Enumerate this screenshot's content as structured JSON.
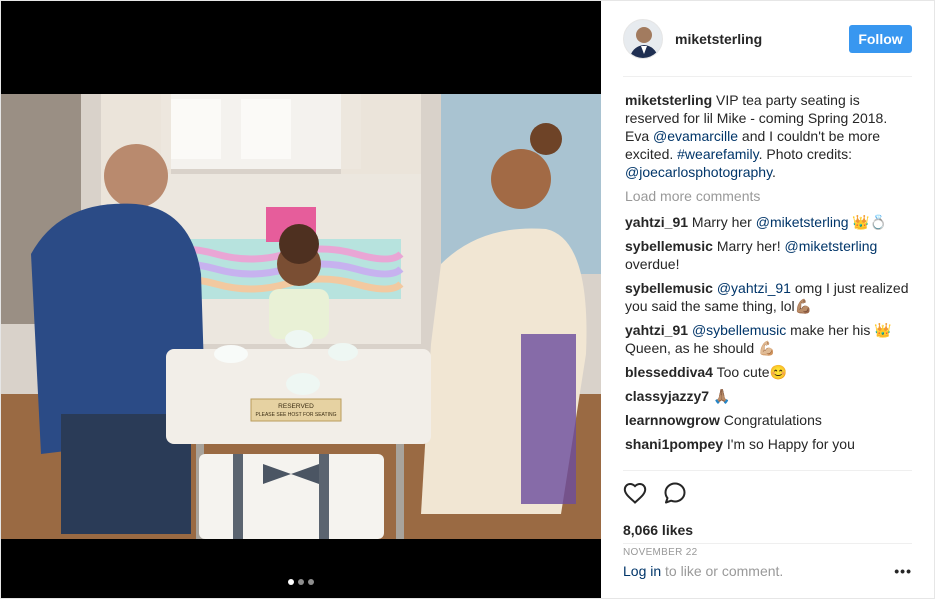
{
  "post": {
    "username": "miketsterling",
    "follow_label": "Follow",
    "caption": {
      "part1": " VIP tea party seating is reserved for lil Mike - coming Spring 2018. Eva ",
      "mention1": "@evamarcille",
      "part2": " and I couldn't be more excited. ",
      "hashtag": "#wearefamily",
      "part3": ". Photo credits: ",
      "mention2": "@joecarlosphotography",
      "part4": "."
    },
    "load_more": "Load more comments",
    "comments": [
      {
        "user": "yahtzi_91",
        "pre": " Marry her ",
        "mention": "@miketsterling",
        "post": " 👑💍"
      },
      {
        "user": "sybellemusic",
        "pre": " Marry her! ",
        "mention": "@miketsterling",
        "post": " overdue!"
      },
      {
        "user": "sybellemusic",
        "pre": " ",
        "mention": "@yahtzi_91",
        "post": " omg I just realized you said the same thing, lol💪🏽"
      },
      {
        "user": "yahtzi_91",
        "pre": " ",
        "mention": "@sybellemusic",
        "post": " make her his 👑 Queen, as he should 💪🏼"
      },
      {
        "user": "blesseddiva4",
        "pre": " Too cute😊",
        "mention": "",
        "post": ""
      },
      {
        "user": "classyjazzy7",
        "pre": " 🙏🏽",
        "mention": "",
        "post": ""
      },
      {
        "user": "learnnowgrow",
        "pre": " Congratulations",
        "mention": "",
        "post": ""
      },
      {
        "user": "shani1pompey",
        "pre": " I'm so Happy for you",
        "mention": "",
        "post": ""
      }
    ],
    "likes": "8,066 likes",
    "date": "NOVEMBER 22",
    "login_link": "Log in",
    "login_rest": " to like or comment.",
    "more_label": "•••",
    "photo_sign": [
      "RESERVED",
      "PLEASE SEE HOST FOR SEATING"
    ],
    "carousel": {
      "count": 3,
      "active": 1
    }
  },
  "icons": [
    "heart-icon",
    "comment-icon",
    "more-options-icon"
  ],
  "colors": {
    "follow": "#3897f0",
    "link": "#003569",
    "muted": "#999999"
  }
}
